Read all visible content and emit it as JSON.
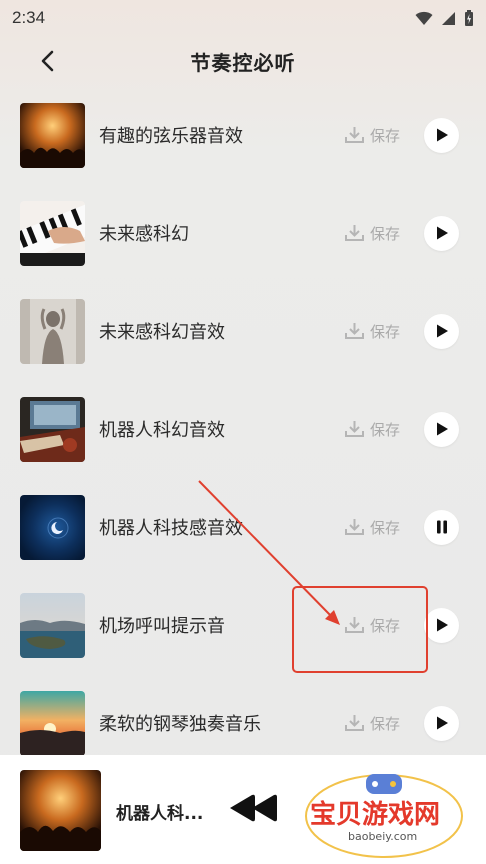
{
  "status_bar": {
    "time": "2:34"
  },
  "header": {
    "title": "节奏控必听"
  },
  "tracks": [
    {
      "title": "有趣的弦乐器音效",
      "save_label": "保存",
      "state": "play"
    },
    {
      "title": "未来感科幻",
      "save_label": "保存",
      "state": "play"
    },
    {
      "title": "未来感科幻音效",
      "save_label": "保存",
      "state": "play"
    },
    {
      "title": "机器人科幻音效",
      "save_label": "保存",
      "state": "play"
    },
    {
      "title": "机器人科技感音效",
      "save_label": "保存",
      "state": "pause"
    },
    {
      "title": "机场呼叫提示音",
      "save_label": "保存",
      "state": "play"
    },
    {
      "title": "柔软的钢琴独奏音乐",
      "save_label": "保存",
      "state": "play"
    }
  ],
  "mini_player": {
    "title": "机器人科..."
  },
  "watermark": {
    "text": "宝贝游戏网",
    "url": "baobeiy.com"
  },
  "colors": {
    "annotation_red": "#e0402f",
    "play_icon": "#111111",
    "save_gray": "#aaaaaa"
  }
}
